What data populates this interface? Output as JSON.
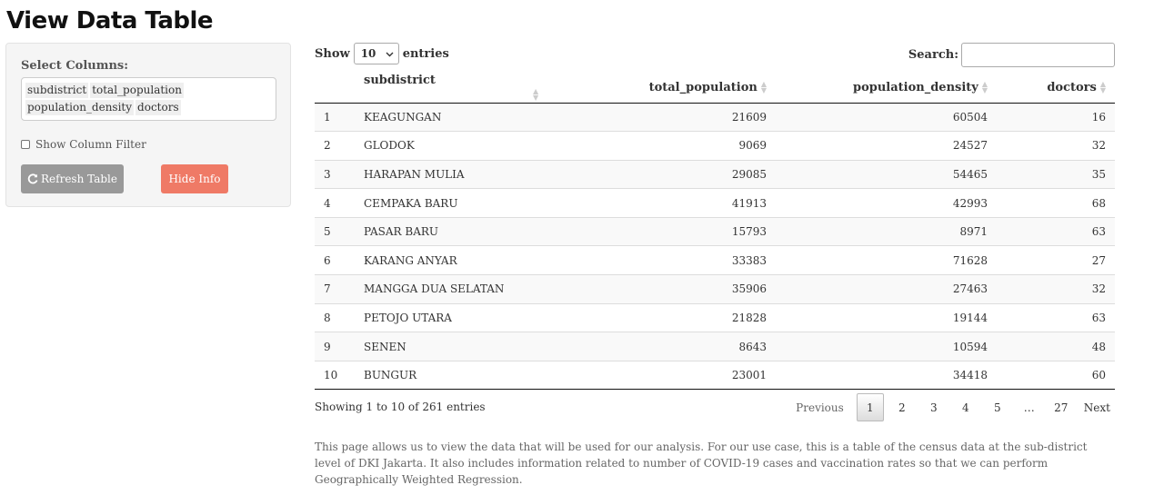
{
  "page": {
    "title": "View Data Table"
  },
  "sidebar": {
    "select_label": "Select Columns:",
    "selected_columns": [
      "subdistrict",
      "total_population",
      "population_density",
      "doctors"
    ],
    "filter_label": "Show Column Filter",
    "refresh_label": "Refresh Table",
    "hide_label": "Hide Info",
    "colors": {
      "refresh": "#999999",
      "hide": "#ef7a66"
    }
  },
  "controls": {
    "show_label": "Show",
    "length_value": "10",
    "entries_label": "entries",
    "search_label": "Search:",
    "search_value": ""
  },
  "table": {
    "columns": [
      "",
      "subdistrict",
      "total_population",
      "population_density",
      "doctors"
    ],
    "rows": [
      [
        "1",
        "KEAGUNGAN",
        "21609",
        "60504",
        "16"
      ],
      [
        "2",
        "GLODOK",
        "9069",
        "24527",
        "32"
      ],
      [
        "3",
        "HARAPAN MULIA",
        "29085",
        "54465",
        "35"
      ],
      [
        "4",
        "CEMPAKA BARU",
        "41913",
        "42993",
        "68"
      ],
      [
        "5",
        "PASAR BARU",
        "15793",
        "8971",
        "63"
      ],
      [
        "6",
        "KARANG ANYAR",
        "33383",
        "71628",
        "27"
      ],
      [
        "7",
        "MANGGA DUA SELATAN",
        "35906",
        "27463",
        "32"
      ],
      [
        "8",
        "PETOJO UTARA",
        "21828",
        "19144",
        "63"
      ],
      [
        "9",
        "SENEN",
        "8643",
        "10594",
        "48"
      ],
      [
        "10",
        "BUNGUR",
        "23001",
        "34418",
        "60"
      ]
    ]
  },
  "info": "Showing 1 to 10 of 261 entries",
  "pagination": {
    "previous": "Previous",
    "pages": [
      "1",
      "2",
      "3",
      "4",
      "5",
      "…",
      "27"
    ],
    "next": "Next",
    "current": "1"
  },
  "footer": "This page allows us to view the data that will be used for our analysis. For our use case, this is a table of the census data at the sub-district level of DKI Jakarta. It also includes information related to number of COVID-19 cases and vaccination rates so that we can perform Geographically Weighted Regression."
}
